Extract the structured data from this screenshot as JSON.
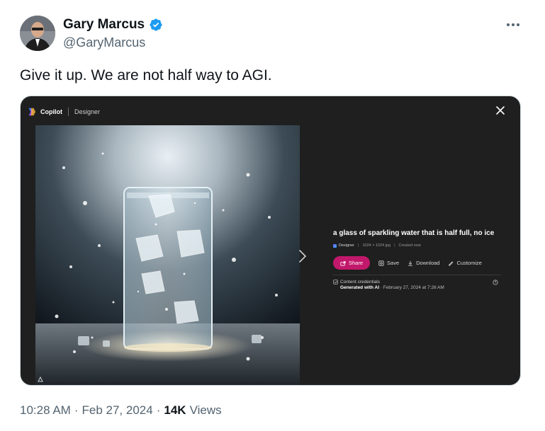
{
  "author": {
    "display_name": "Gary Marcus",
    "handle": "@GaryMarcus",
    "verified": true
  },
  "tweet": {
    "text": "Give it up. We are not half way to AGI."
  },
  "media": {
    "brand": "Copilot",
    "app": "Designer",
    "prompt": "a glass of sparkling water that is half full, no ice",
    "meta": {
      "source": "Designer",
      "dimensions": "1024 × 1024 jpg",
      "status": "Created now"
    },
    "actions": {
      "share": "Share",
      "save": "Save",
      "download": "Download",
      "customize": "Customize"
    },
    "credentials": {
      "label": "Content credentials",
      "generated": "Generated with AI",
      "date": " · February 27, 2024 at 7:26 AM"
    },
    "colors": {
      "share_button": "#c2186b",
      "panel": "#1f1f1f"
    }
  },
  "footer": {
    "time": "10:28 AM",
    "dot1": "·",
    "date": "Feb 27, 2024",
    "dot2": "·",
    "views_count": "14K",
    "views_label": "Views"
  },
  "icons": [
    "verified-badge-icon",
    "more-icon",
    "copilot-logo-icon",
    "close-icon",
    "chevron-right-icon",
    "share-icon",
    "save-icon",
    "download-icon",
    "customize-icon",
    "credentials-icon",
    "help-icon"
  ]
}
